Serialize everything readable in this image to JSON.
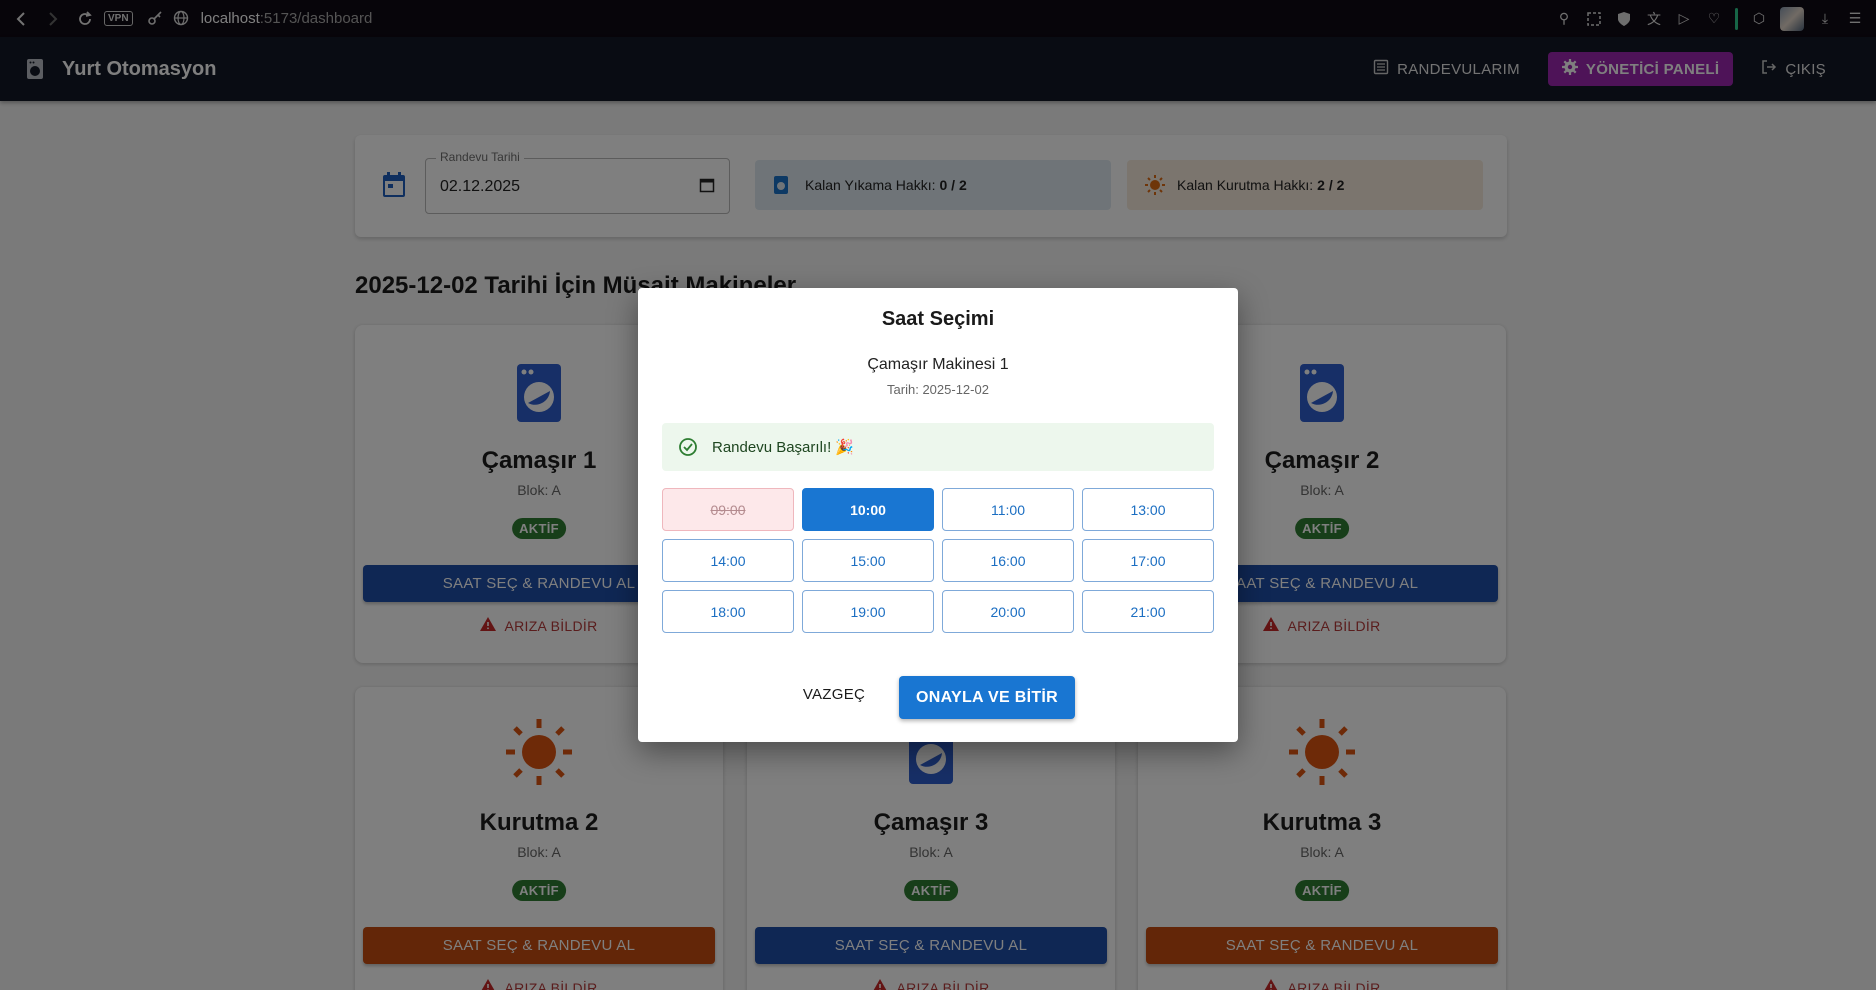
{
  "browser": {
    "vpn_label": "VPN",
    "url_host": "localhost",
    "url_path": ":5173/dashboard"
  },
  "header": {
    "title": "Yurt Otomasyon",
    "my_appointments": "RANDEVULARIM",
    "admin_panel": "YÖNETİCİ PANELİ",
    "logout": "ÇIKIŞ"
  },
  "date_panel": {
    "legend": "Randevu Tarihi",
    "value": "02.12.2025",
    "wash_label": "Kalan Yıkama Hakkı:",
    "wash_value": "0 / 2",
    "dry_label": "Kalan Kurutma Hakkı:",
    "dry_value": "2 / 2"
  },
  "section_title": "2025-12-02 Tarihi İçin Müsait Makineler",
  "machines": [
    {
      "name": "Çamaşır 1",
      "block": "Blok: A",
      "status": "AKTİF",
      "type": "washer",
      "button": "SAAT SEÇ & RANDEVU AL",
      "fault": "ARIZA BİLDİR"
    },
    {
      "name": "Çamaşır 2",
      "block": "Blok: A",
      "status": "AKTİF",
      "type": "washer",
      "button": "SAAT SEÇ & RANDEVU AL",
      "fault": "ARIZA BİLDİR"
    },
    {
      "name": "Kurutma 2",
      "block": "Blok: A",
      "status": "AKTİF",
      "type": "dryer",
      "button": "SAAT SEÇ & RANDEVU AL",
      "fault": "ARIZA BİLDİR"
    },
    {
      "name": "Çamaşır 3",
      "block": "Blok: A",
      "status": "AKTİF",
      "type": "washer",
      "button": "SAAT SEÇ & RANDEVU AL",
      "fault": "ARIZA BİLDİR"
    },
    {
      "name": "Kurutma 3",
      "block": "Blok: A",
      "status": "AKTİF",
      "type": "dryer",
      "button": "SAAT SEÇ & RANDEVU AL",
      "fault": "ARIZA BİLDİR"
    }
  ],
  "modal": {
    "title": "Saat Seçimi",
    "machine": "Çamaşır Makinesi 1",
    "date": "Tarih: 2025-12-02",
    "alert": "Randevu Başarılı! 🎉",
    "slots": [
      {
        "time": "09:00",
        "state": "disabled"
      },
      {
        "time": "10:00",
        "state": "selected"
      },
      {
        "time": "11:00",
        "state": "available"
      },
      {
        "time": "13:00",
        "state": "available"
      },
      {
        "time": "14:00",
        "state": "available"
      },
      {
        "time": "15:00",
        "state": "available"
      },
      {
        "time": "16:00",
        "state": "available"
      },
      {
        "time": "17:00",
        "state": "available"
      },
      {
        "time": "18:00",
        "state": "available"
      },
      {
        "time": "19:00",
        "state": "available"
      },
      {
        "time": "20:00",
        "state": "available"
      },
      {
        "time": "21:00",
        "state": "available"
      }
    ],
    "cancel": "VAZGEÇ",
    "confirm": "ONAYLA VE BİTİR"
  },
  "colors": {
    "washer_icon": "#2f5fcf",
    "dryer_icon": "#dd5511",
    "primary": "#1976d2",
    "admin": "#9c27b0",
    "status_green": "#2e7d32"
  }
}
